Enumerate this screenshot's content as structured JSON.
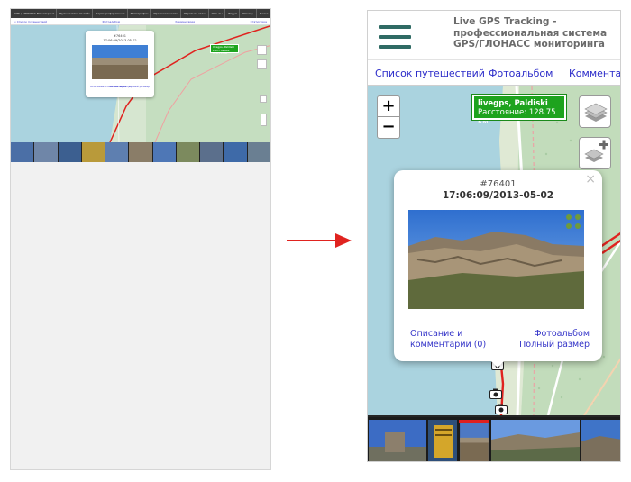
{
  "thumbnail": {
    "menu_items": [
      "GPS / ГЛОНАСС Мониторинг",
      "Путешествия Онлайн",
      "Картографирование",
      "Фотографии",
      "Профессионалам",
      "Обратная связь",
      "Отзывы",
      "Форум",
      "Помощь",
      "Поиск"
    ],
    "subbar_left": "« Список путешествий",
    "subbar_links": [
      "Фотоальбом",
      "Комментарии",
      "Статистика"
    ],
    "popup_id": "#76401",
    "popup_date": "17:06:09/2013-05-02",
    "popup_desc": "Описание и комментарии (0)",
    "popup_album": "Фотоальбом Полный размер",
    "badge_name": "livegps, Paldiski",
    "badge_distance": "Расстояние: 128.75 км."
  },
  "header": {
    "menu_icon": "hamburger-menu-icon",
    "title": "Live GPS Tracking - профессиональная система GPS/ГЛОНАСС мониторинга"
  },
  "nav": {
    "items": [
      "Список путешествий",
      "Фотоальбом",
      "Комментарии"
    ]
  },
  "map": {
    "zoom_in": "+",
    "zoom_out": "−",
    "track_badge": {
      "name": "livegps, Paldiski",
      "distance_label": "Расстояние:",
      "distance_value": "128.75 км."
    },
    "layers_icon": "layers-icon",
    "overlay_icon": "add-overlay-icon",
    "marker_icon": "camera-marker-icon",
    "track_color": "#e0231f"
  },
  "popup": {
    "close": "×",
    "id": "#76401",
    "datetime": "17:06:09/2013-05-02",
    "description_link": "Описание и комментарии (0)",
    "album_link": "Фотоальбом",
    "fullsize_link": "Полный размер"
  },
  "colors": {
    "accent_link": "#2b2bc9",
    "badge_green": "#1ea31e",
    "hamburger": "#2f6b64",
    "track_red": "#e0231f",
    "map_grass": "#cfe3cc",
    "map_sea": "#aad3df"
  }
}
